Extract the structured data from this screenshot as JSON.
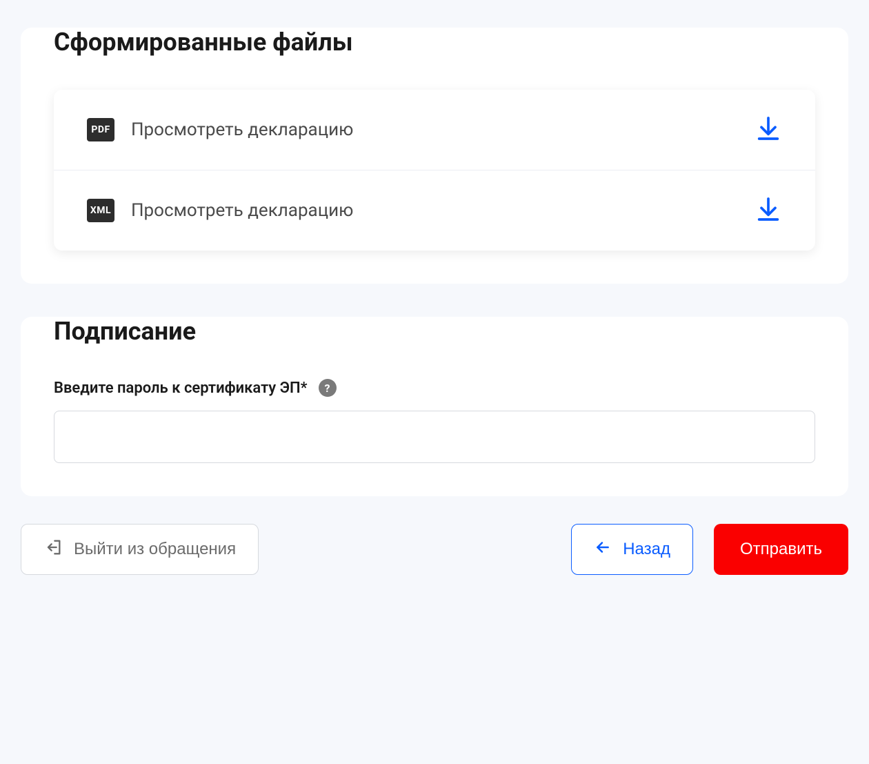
{
  "files_section": {
    "title": "Сформированные файлы",
    "items": [
      {
        "badge": "PDF",
        "label": "Просмотреть декларацию"
      },
      {
        "badge": "XML",
        "label": "Просмотреть декларацию"
      }
    ]
  },
  "sign_section": {
    "title": "Подписание",
    "password_label": "Введите пароль к сертификату ЭП*",
    "password_value": ""
  },
  "buttons": {
    "exit": "Выйти из обращения",
    "back": "Назад",
    "submit": "Отправить"
  }
}
